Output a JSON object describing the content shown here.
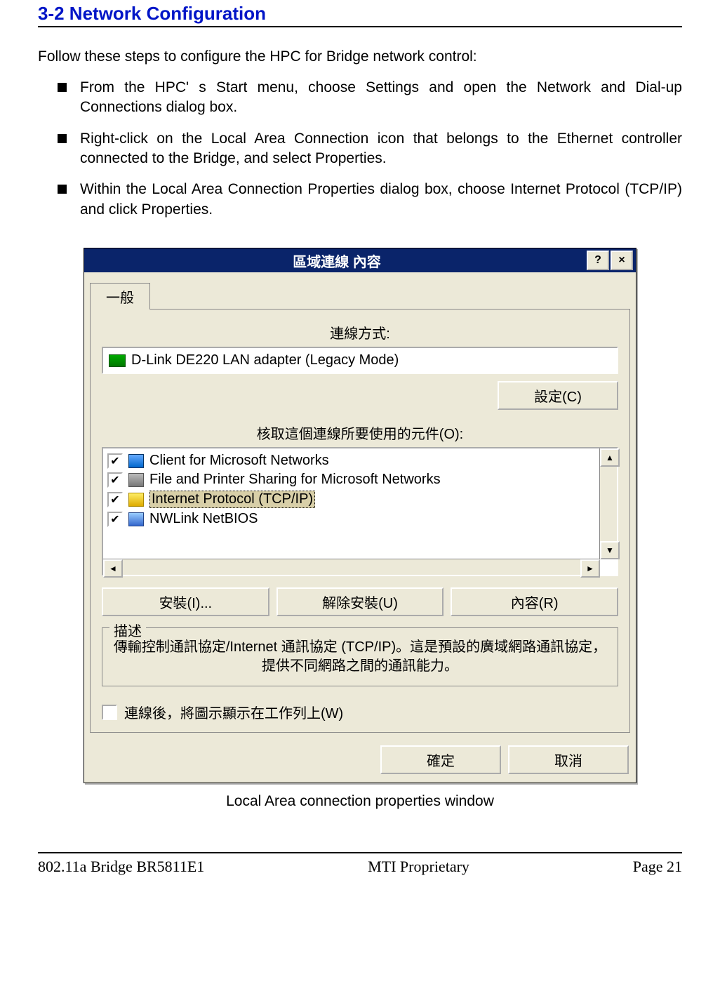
{
  "heading": "3-2 Network Configuration",
  "intro": "Follow these steps to configure the HPC for Bridge network control:",
  "steps": [
    "From the HPC' s Start menu, choose Settings and open the Network and Dial-up Connections dialog box.",
    "Right-click on the Local Area Connection icon that belongs to the Ethernet controller connected to the Bridge, and select Properties.",
    "Within the Local Area Connection Properties dialog box, choose Internet Protocol (TCP/IP) and click Properties."
  ],
  "caption": "Local Area connection properties window",
  "dialog": {
    "title": "區域連線 內容",
    "help_btn": "?",
    "close_btn": "×",
    "tab_general": "一般",
    "label_connect_using": "連線方式:",
    "adapter": "D-Link DE220 LAN adapter (Legacy Mode)",
    "btn_configure": "設定(C)",
    "label_components": "核取這個連線所要使用的元件(O):",
    "components": [
      {
        "label": "Client for Microsoft Networks",
        "checked": true,
        "icon": "ic-mon",
        "selected": false
      },
      {
        "label": "File and Printer Sharing for Microsoft Networks",
        "checked": true,
        "icon": "ic-prn",
        "selected": false
      },
      {
        "label": "Internet Protocol (TCP/IP)",
        "checked": true,
        "icon": "ic-net",
        "selected": true
      },
      {
        "label": "NWLink NetBIOS",
        "checked": true,
        "icon": "ic-net2",
        "selected": false
      }
    ],
    "btn_install": "安裝(I)...",
    "btn_uninstall": "解除安裝(U)",
    "btn_properties": "內容(R)",
    "group_description": "描述",
    "description_text": "傳輸控制通訊協定/Internet 通訊協定 (TCP/IP)。這是預設的廣域網路通訊協定，提供不同網路之間的通訊能力。",
    "show_icon_label": "連線後，將圖示顯示在工作列上(W)",
    "btn_ok": "確定",
    "btn_cancel": "取消"
  },
  "footer": {
    "left": "802.11a Bridge BR5811E1",
    "center": "MTI Proprietary",
    "right": "Page 21"
  }
}
